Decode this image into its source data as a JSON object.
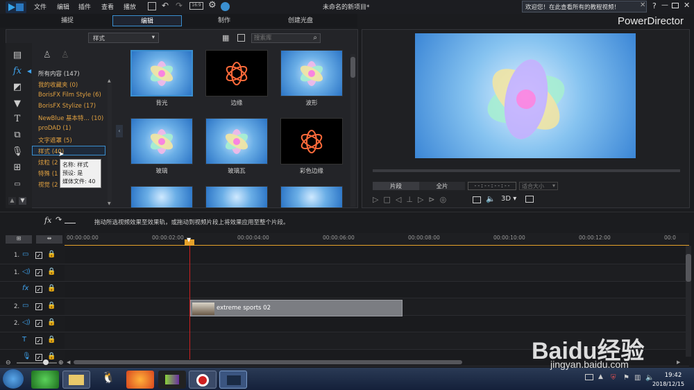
{
  "menu": {
    "file": "文件",
    "edit": "编辑",
    "plugin": "插件",
    "view": "查看",
    "play": "播放"
  },
  "window": {
    "title": "未命名的新项目*",
    "app": "PowerDirector",
    "welcome": "欢迎您！在此查看所有的教程视频！",
    "help": "?"
  },
  "tabs": {
    "capture": "捕捉",
    "edit": "编辑",
    "produce": "制作",
    "disc": "创建光盘"
  },
  "library": {
    "dropdown": "样式",
    "search_placeholder": "搜索库"
  },
  "categories": [
    {
      "label": "所有内容 (147)",
      "white": true
    },
    {
      "label": "我的收藏夹 (0)"
    },
    {
      "label": "BorisFX Film Style (6)"
    },
    {
      "label": "BorisFX Stylize (17)"
    },
    {
      "label": "NewBlue 基本特… (10)"
    },
    {
      "label": "proDAD (1)"
    },
    {
      "label": "文字遮罩 (5)"
    },
    {
      "label": "样式 (40)"
    },
    {
      "label": "炫粒 (2"
    },
    {
      "label": "特殊 (1"
    },
    {
      "label": "视觉 (2"
    }
  ],
  "tooltip": {
    "name": "名称: 样式",
    "preset": "预设: 是",
    "media": "媒体文件: 40"
  },
  "effects": [
    {
      "label": "背光",
      "style": "blue",
      "selected": true
    },
    {
      "label": "边缘",
      "style": "dark"
    },
    {
      "label": "波形",
      "style": "blue"
    },
    {
      "label": "玻璃",
      "style": "blue"
    },
    {
      "label": "玻璃瓦",
      "style": "blue"
    },
    {
      "label": "彩色边缘",
      "style": "dark"
    }
  ],
  "preview": {
    "clip": "片段",
    "movie": "全片",
    "timecode": "--:--:--:--",
    "fit": "适合大小",
    "mode": "3D"
  },
  "hint": "拖动所选视频效果至效果轨，或拖动到视频片段上将效果应用至整个片段。",
  "ruler": [
    "00:00:00:00",
    "00:00:02:00",
    "00:00:04:00",
    "00:00:06:00",
    "00:00:08:00",
    "00:00:10:00",
    "00:00:12:00",
    "00:0"
  ],
  "tracks": [
    {
      "num": "1.",
      "kind": "video"
    },
    {
      "num": "1.",
      "kind": "audio"
    },
    {
      "num": "",
      "kind": "fx"
    },
    {
      "num": "2.",
      "kind": "video"
    },
    {
      "num": "2.",
      "kind": "audio"
    },
    {
      "num": "",
      "kind": "title"
    },
    {
      "num": "",
      "kind": "voice"
    }
  ],
  "clip": {
    "label": "extreme sports 02"
  },
  "clock": {
    "time": "19:42",
    "date": "2018/12/15"
  },
  "watermark": {
    "brand": "Baidu经验",
    "url": "jingyan.baidu.com"
  }
}
